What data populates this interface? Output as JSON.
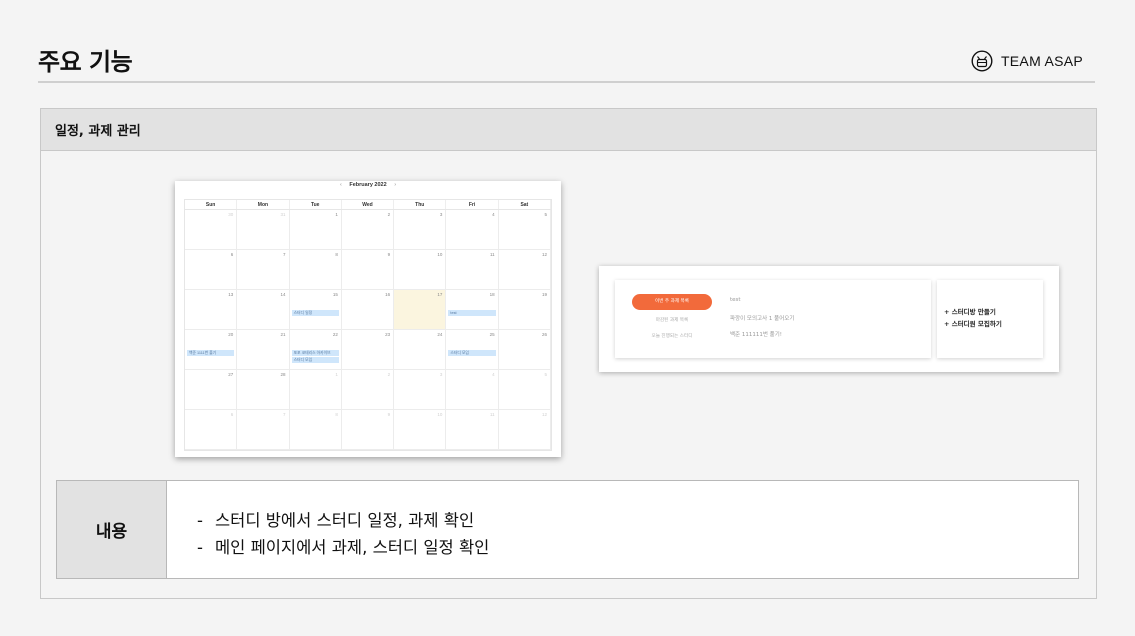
{
  "header": {
    "title": "주요 기능",
    "brand_name": "TEAM ASAP",
    "brand_icon": "team-asap-logo-icon"
  },
  "section": {
    "title": "일정, 과제 관리"
  },
  "calendar": {
    "month_label": "February 2022",
    "prev_arrow": "‹",
    "next_arrow": "›",
    "weekdays": [
      "Sun",
      "Mon",
      "Tue",
      "Wed",
      "Thu",
      "Fri",
      "Sat"
    ],
    "weeks": [
      [
        {
          "d": "30",
          "f": true
        },
        {
          "d": "31",
          "f": true
        },
        {
          "d": "1"
        },
        {
          "d": "2"
        },
        {
          "d": "3"
        },
        {
          "d": "4"
        },
        {
          "d": "5"
        }
      ],
      [
        {
          "d": "6"
        },
        {
          "d": "7"
        },
        {
          "d": "8"
        },
        {
          "d": "9"
        },
        {
          "d": "10"
        },
        {
          "d": "11"
        },
        {
          "d": "12"
        }
      ],
      [
        {
          "d": "13"
        },
        {
          "d": "14"
        },
        {
          "d": "15",
          "ev": [
            "스터디 일정"
          ]
        },
        {
          "d": "16"
        },
        {
          "d": "17",
          "today": true
        },
        {
          "d": "18",
          "ev": [
            "test"
          ]
        },
        {
          "d": "19"
        }
      ],
      [
        {
          "d": "20",
          "ev": [
            "백준 1111번 풀기"
          ]
        },
        {
          "d": "21"
        },
        {
          "d": "22",
          "ev": [
            "포포 코테리스 아카이브",
            "스터디 모임"
          ]
        },
        {
          "d": "23"
        },
        {
          "d": "24"
        },
        {
          "d": "25",
          "ev": [
            "스터디 모임"
          ]
        },
        {
          "d": "26"
        }
      ],
      [
        {
          "d": "27"
        },
        {
          "d": "28"
        },
        {
          "d": "1",
          "f": true
        },
        {
          "d": "2",
          "f": true
        },
        {
          "d": "3",
          "f": true
        },
        {
          "d": "4",
          "f": true
        },
        {
          "d": "5",
          "f": true
        }
      ],
      [
        {
          "d": "6",
          "f": true
        },
        {
          "d": "7",
          "f": true
        },
        {
          "d": "8",
          "f": true
        },
        {
          "d": "9",
          "f": true
        },
        {
          "d": "10",
          "f": true
        },
        {
          "d": "11",
          "f": true
        },
        {
          "d": "12",
          "f": true
        }
      ]
    ]
  },
  "mainpage": {
    "tab_active": "이번 주 과제 목록",
    "tab_2": "마감된 과제 목록",
    "tab_3": "오늘 진행되는 스터디",
    "items": [
      "test",
      "파깡이 모의고사 1 풀어오기",
      "백준 111111번 풀기!"
    ],
    "links": [
      "+ 스터디방 만들기",
      "+ 스터디원 모집하기"
    ]
  },
  "content": {
    "label": "내용",
    "lines": [
      "스터디 방에서 스터디 일정, 과제 확인",
      "메인 페이지에서 과제, 스터디 일정 확인"
    ]
  },
  "colors": {
    "accent": "#f26a3b",
    "event": "#cfe6fb",
    "today": "#fbf5df"
  }
}
